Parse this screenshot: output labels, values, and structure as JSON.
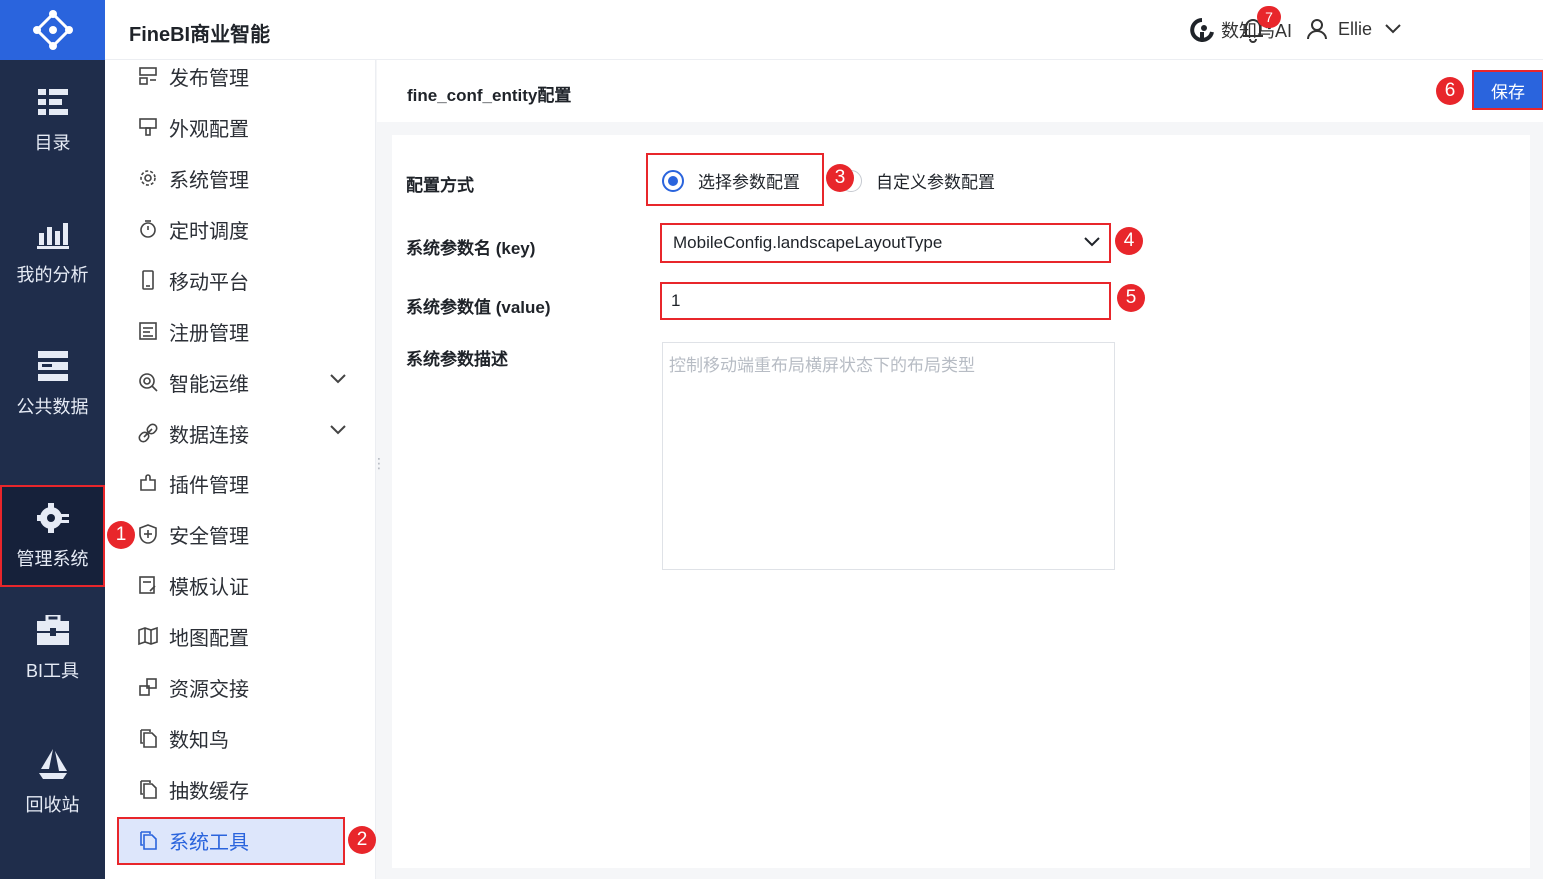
{
  "header": {
    "app_title": "FineBI商业智能",
    "ai_label": "数知鸟AI",
    "notification_count": "7",
    "user_name": "Ellie"
  },
  "rail": {
    "items": [
      {
        "label": "目录",
        "icon": "list-icon"
      },
      {
        "label": "我的分析",
        "icon": "chart-icon"
      },
      {
        "label": "公共数据",
        "icon": "database-icon"
      },
      {
        "label": "管理系统",
        "icon": "gear-icon",
        "active": true
      },
      {
        "label": "BI工具",
        "icon": "toolbox-icon"
      },
      {
        "label": "回收站",
        "icon": "recycle-icon"
      }
    ]
  },
  "subnav": {
    "items": [
      {
        "label": "发布管理",
        "icon": "publish-icon"
      },
      {
        "label": "外观配置",
        "icon": "palette-icon"
      },
      {
        "label": "系统管理",
        "icon": "gear-icon"
      },
      {
        "label": "定时调度",
        "icon": "timer-icon"
      },
      {
        "label": "移动平台",
        "icon": "mobile-icon"
      },
      {
        "label": "注册管理",
        "icon": "register-icon"
      },
      {
        "label": "智能运维",
        "icon": "maintenance-icon",
        "expandable": true
      },
      {
        "label": "数据连接",
        "icon": "link-icon",
        "expandable": true
      },
      {
        "label": "插件管理",
        "icon": "plugin-icon"
      },
      {
        "label": "安全管理",
        "icon": "shield-icon"
      },
      {
        "label": "模板认证",
        "icon": "certificate-icon"
      },
      {
        "label": "地图配置",
        "icon": "map-icon"
      },
      {
        "label": "资源交接",
        "icon": "transfer-icon"
      },
      {
        "label": "数知鸟",
        "icon": "copy-icon"
      },
      {
        "label": "抽数缓存",
        "icon": "copy-icon"
      },
      {
        "label": "系统工具",
        "icon": "copy-icon",
        "active": true
      }
    ]
  },
  "content": {
    "title": "fine_conf_entity配置",
    "save_label": "保存",
    "form": {
      "mode_label": "配置方式",
      "mode_options": [
        "选择参数配置",
        "自定义参数配置"
      ],
      "mode_selected": "选择参数配置",
      "key_label": "系统参数名 (key)",
      "key_value": "MobileConfig.landscapeLayoutType",
      "value_label": "系统参数值 (value)",
      "value_value": "1",
      "desc_label": "系统参数描述",
      "desc_placeholder": "控制移动端重布局横屏状态下的布局类型"
    }
  },
  "annotations": [
    "1",
    "2",
    "3",
    "4",
    "5",
    "6"
  ],
  "colors": {
    "accent": "#2a64dd",
    "rail_bg": "#1f2d4b",
    "highlight": "#e8262b"
  }
}
